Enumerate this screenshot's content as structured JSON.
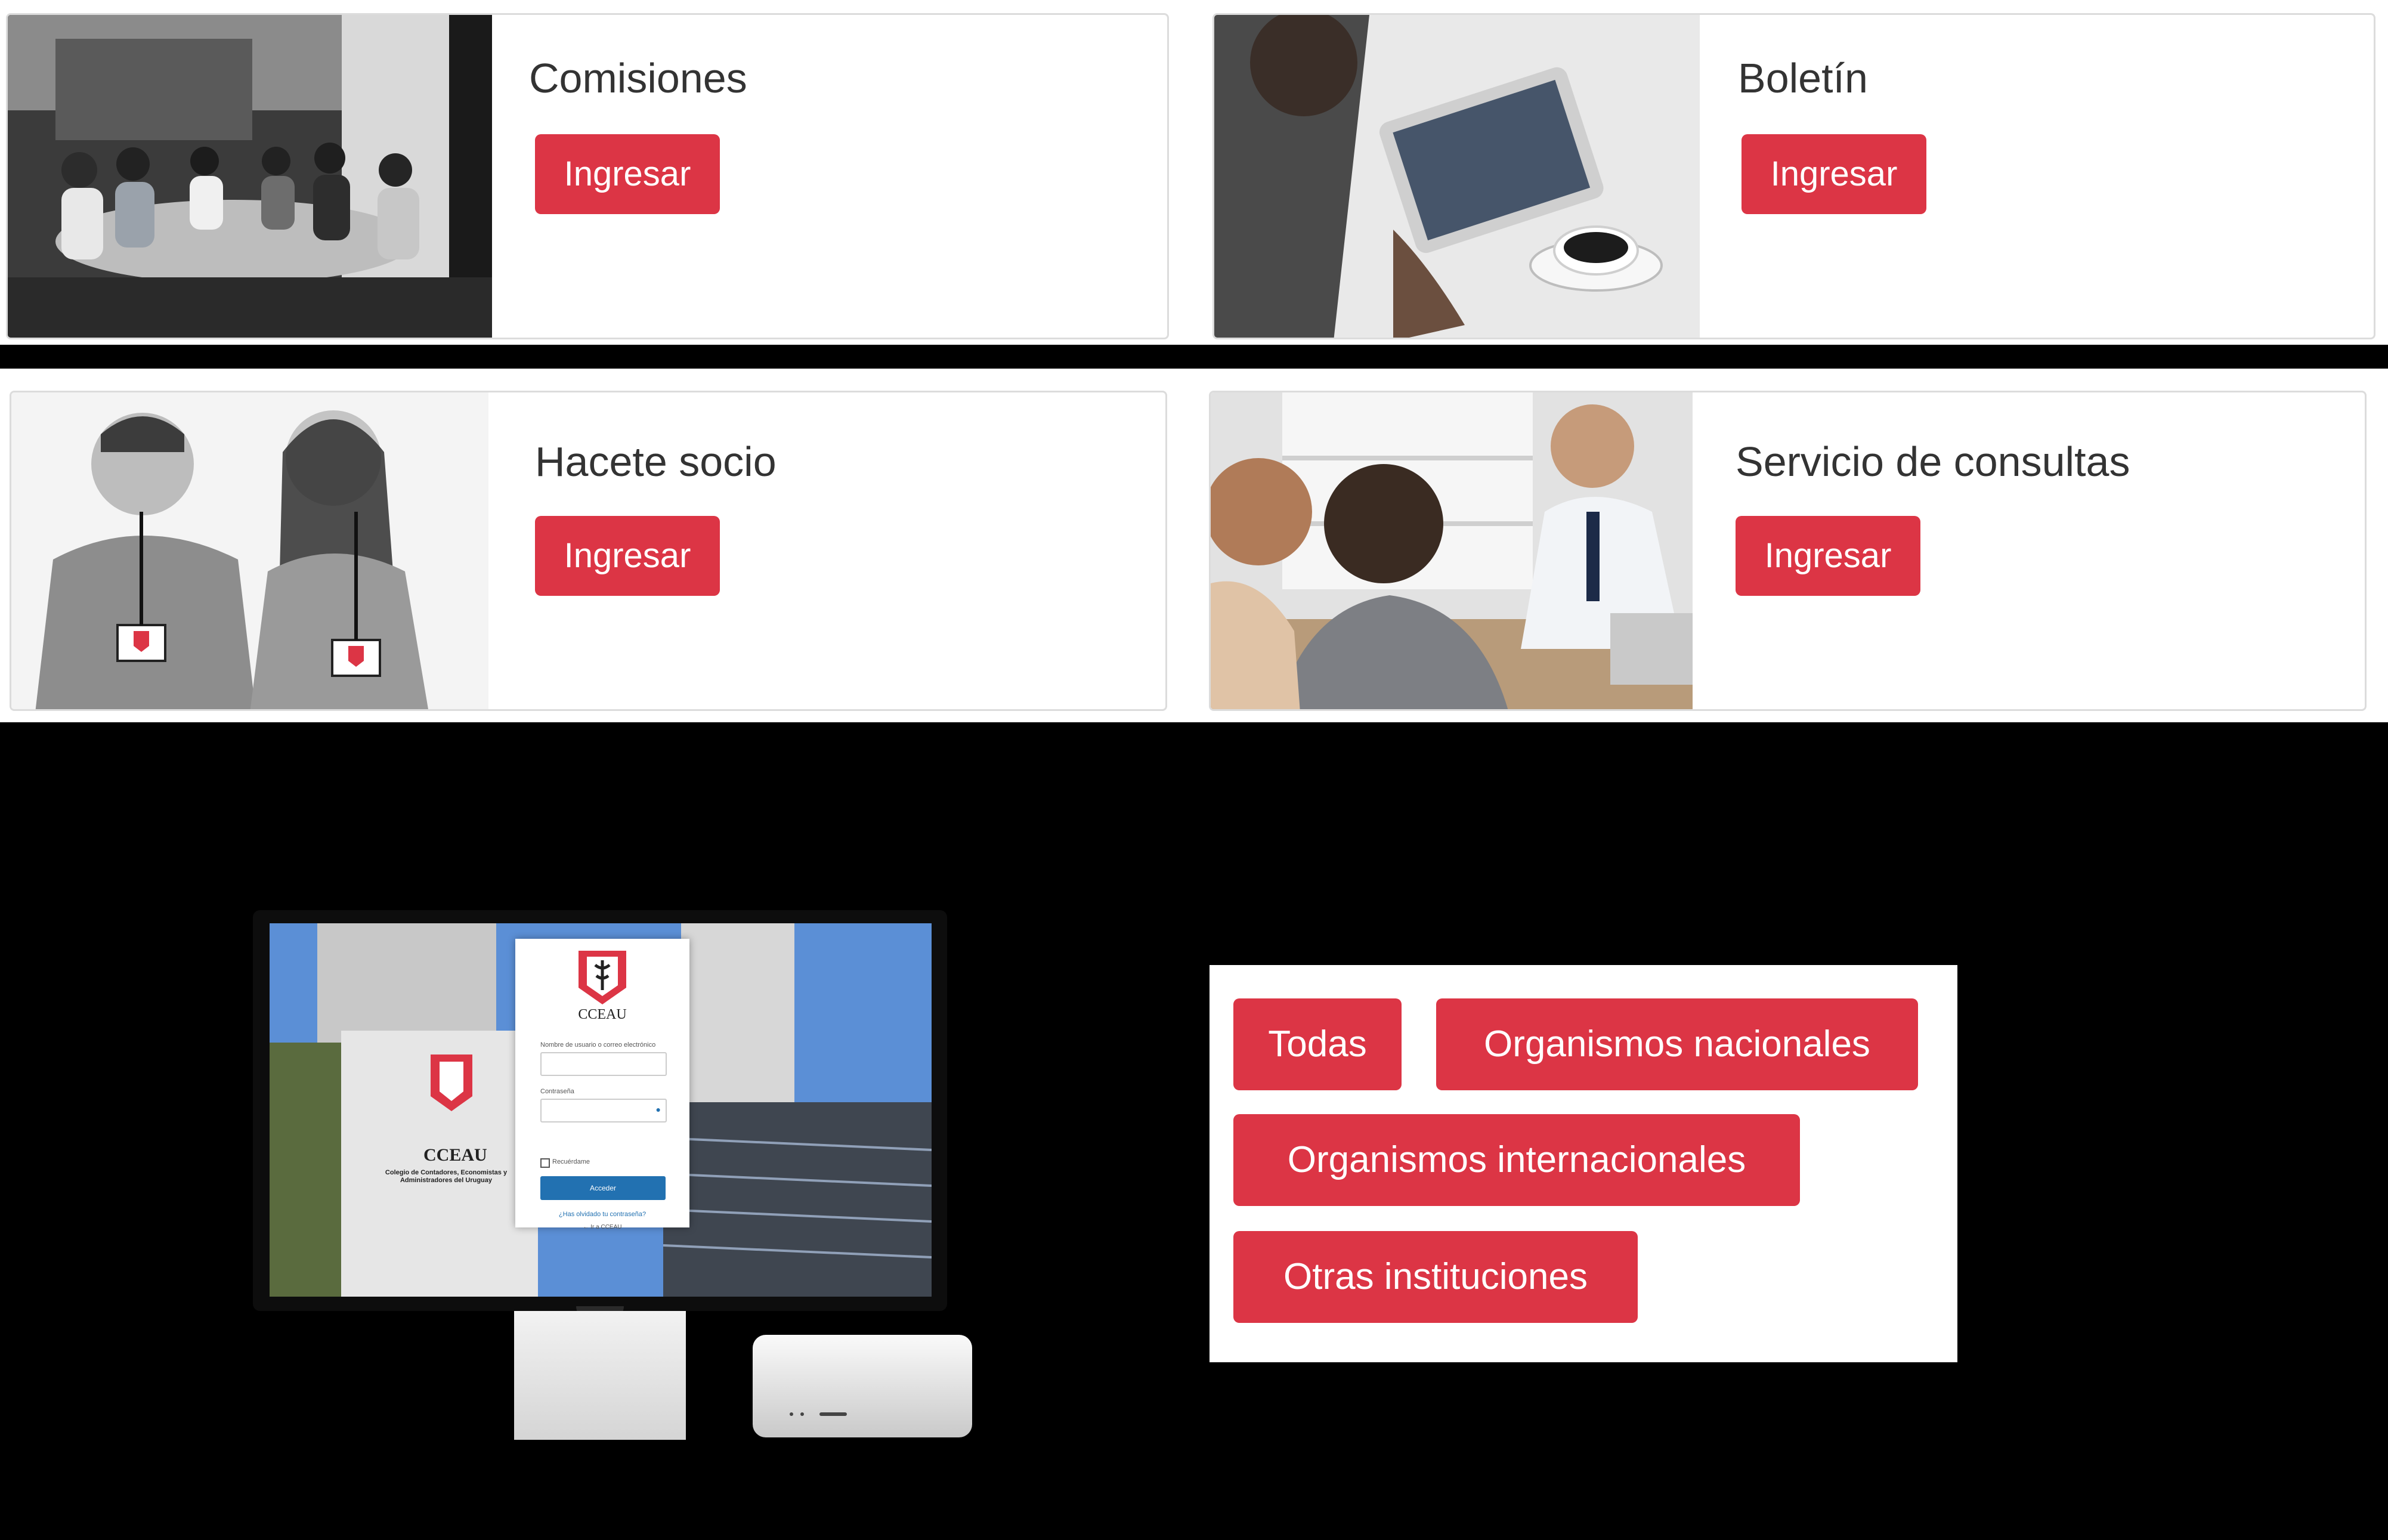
{
  "cards": [
    {
      "title": "Comisiones",
      "button": "Ingresar"
    },
    {
      "title": "Boletín",
      "button": "Ingresar"
    },
    {
      "title": "Hacete socio",
      "button": "Ingresar"
    },
    {
      "title": "Servicio de consultas",
      "button": "Ingresar"
    }
  ],
  "login_screen": {
    "brand": "CCEAU",
    "building_sign": "CCEAU",
    "building_caption": "Colegio de Contadores, Economistas y Administradores del Uruguay",
    "username_label": "Nombre de usuario o correo electrónico",
    "password_label": "Contraseña",
    "remember_label": "Recuérdame",
    "submit_label": "Acceder",
    "lost_password": "¿Has olvidado tu contraseña?",
    "back_link": "← Ir a CCEAU"
  },
  "filters": [
    "Todas",
    "Organismos nacionales",
    "Organismos internacionales",
    "Otras instituciones"
  ],
  "colors": {
    "accent": "#dc3545",
    "page_background": "#000000",
    "card_background": "#ffffff"
  }
}
